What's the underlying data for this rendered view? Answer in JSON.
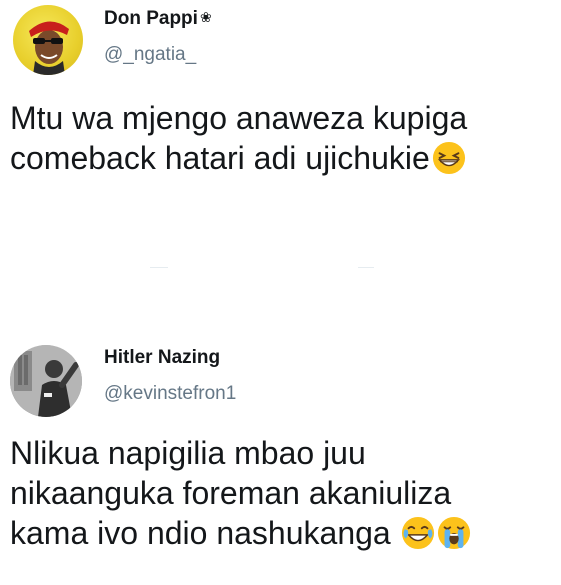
{
  "tweets": [
    {
      "display_name": "Don Pappi",
      "name_emoji": "❀",
      "handle": "@_ngatia_",
      "text_lines": [
        "Mtu wa mjengo anaweza kupiga",
        "comeback hatari adi ujichukie"
      ],
      "trailing_emojis": [
        "grinning-squinting-face"
      ]
    },
    {
      "display_name": "Hitler Nazing",
      "handle": "@kevinstefron1",
      "text_lines": [
        "Nlikua napigilia mbao juu",
        "nikaanguka foreman akaniuliza",
        "kama ivo ndio nashukanga"
      ],
      "trailing_emojis": [
        "face-with-tears-of-joy",
        "loudly-crying-face"
      ]
    }
  ],
  "colors": {
    "text": "#14171a",
    "handle": "#657786",
    "background": "#ffffff",
    "emoji_yellow": "#fcc21b"
  }
}
